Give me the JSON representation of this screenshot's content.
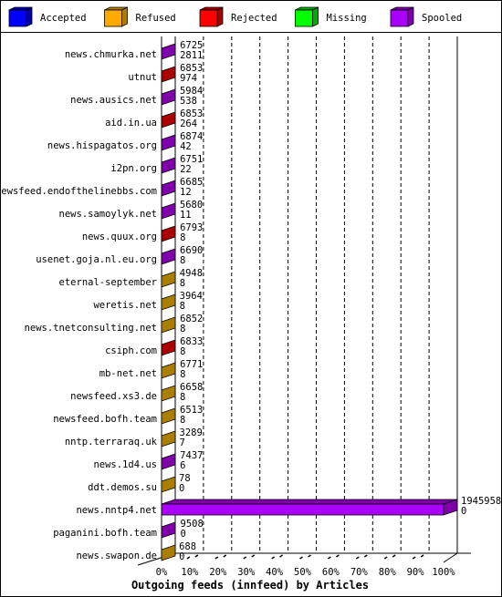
{
  "chart_data": {
    "type": "bar",
    "orientation": "horizontal",
    "stacked": true,
    "three_d": true,
    "title": "Outgoing feeds (innfeed) by Articles",
    "xlim": [
      0,
      100
    ],
    "x_unit": "%",
    "x_ticks": [
      "0%",
      "10%",
      "20%",
      "30%",
      "40%",
      "50%",
      "60%",
      "70%",
      "80%",
      "90%",
      "100%"
    ],
    "grid": "vertical dashed",
    "legend_placement": "top",
    "legend": [
      {
        "name": "Accepted",
        "color": "#0000ff",
        "side": "#0000aa"
      },
      {
        "name": "Refused",
        "color": "#ffaa00",
        "side": "#aa7f00"
      },
      {
        "name": "Rejected",
        "color": "#ff0000",
        "side": "#aa0000"
      },
      {
        "name": "Missing",
        "color": "#00ff00",
        "side": "#00aa00"
      },
      {
        "name": "Spooled",
        "color": "#aa00ff",
        "side": "#7f00aa"
      }
    ],
    "rows": [
      {
        "name": "news.chmurka.net",
        "values": [
          "6725",
          "2811"
        ],
        "visible": "Spooled"
      },
      {
        "name": "utnut",
        "values": [
          "6853",
          "974"
        ],
        "visible": "Rejected"
      },
      {
        "name": "news.ausics.net",
        "values": [
          "5984",
          "538"
        ],
        "visible": "Spooled"
      },
      {
        "name": "aid.in.ua",
        "values": [
          "6853",
          "264"
        ],
        "visible": "Rejected"
      },
      {
        "name": "news.hispagatos.org",
        "values": [
          "6874",
          "42"
        ],
        "visible": "Spooled"
      },
      {
        "name": "i2pn.org",
        "values": [
          "6751",
          "22"
        ],
        "visible": "Spooled"
      },
      {
        "name": "newsfeed.endofthelinebbs.com",
        "values": [
          "6685",
          "12"
        ],
        "visible": "Spooled"
      },
      {
        "name": "news.samoylyk.net",
        "values": [
          "5680",
          "11"
        ],
        "visible": "Spooled"
      },
      {
        "name": "news.quux.org",
        "values": [
          "6793",
          "8"
        ],
        "visible": "Rejected"
      },
      {
        "name": "usenet.goja.nl.eu.org",
        "values": [
          "6690",
          "8"
        ],
        "visible": "Spooled"
      },
      {
        "name": "eternal-september",
        "values": [
          "4948",
          "8"
        ],
        "visible": "Refused"
      },
      {
        "name": "weretis.net",
        "values": [
          "3964",
          "8"
        ],
        "visible": "Refused"
      },
      {
        "name": "news.tnetconsulting.net",
        "values": [
          "6852",
          "8"
        ],
        "visible": "Refused"
      },
      {
        "name": "csiph.com",
        "values": [
          "6833",
          "8"
        ],
        "visible": "Rejected"
      },
      {
        "name": "mb-net.net",
        "values": [
          "6771",
          "8"
        ],
        "visible": "Refused"
      },
      {
        "name": "newsfeed.xs3.de",
        "values": [
          "6658",
          "8"
        ],
        "visible": "Refused"
      },
      {
        "name": "newsfeed.bofh.team",
        "values": [
          "6513",
          "8"
        ],
        "visible": "Refused"
      },
      {
        "name": "nntp.terraraq.uk",
        "values": [
          "3289",
          "7"
        ],
        "visible": "Refused"
      },
      {
        "name": "news.1d4.us",
        "values": [
          "7437",
          "6"
        ],
        "visible": "Spooled"
      },
      {
        "name": "ddt.demos.su",
        "values": [
          "78",
          "0"
        ],
        "visible": "Refused"
      },
      {
        "name": "news.nntp4.net",
        "values": [
          "1945958",
          "0"
        ],
        "visible": "Spooled"
      },
      {
        "name": "paganini.bofh.team",
        "values": [
          "9508",
          "0"
        ],
        "visible": "Spooled"
      },
      {
        "name": "news.swapon.de",
        "values": [
          "688",
          "0"
        ],
        "visible": "Refused"
      }
    ]
  }
}
